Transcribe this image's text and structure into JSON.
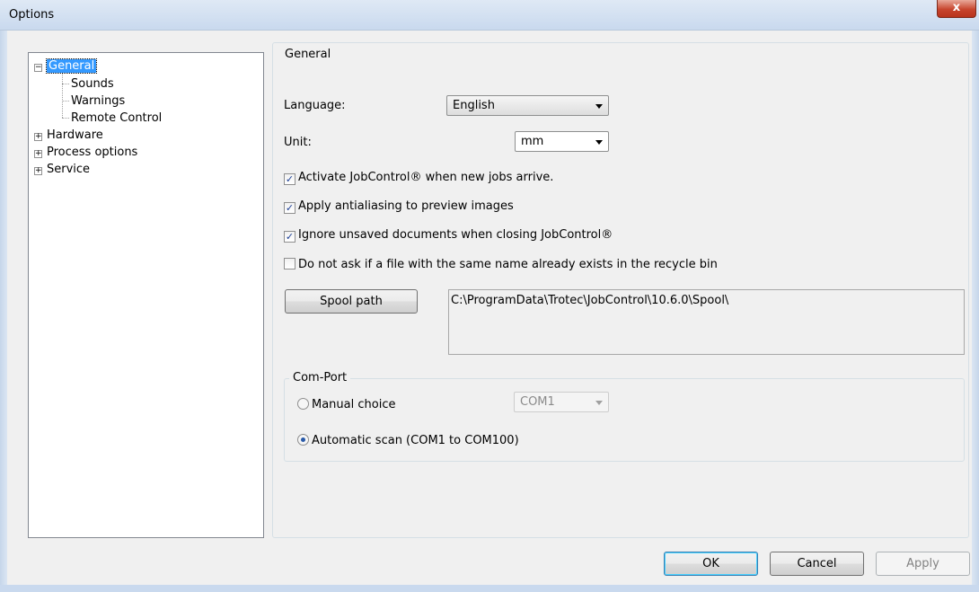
{
  "window": {
    "title": "Options",
    "close_label": "x"
  },
  "tree": {
    "items": [
      {
        "label": "General",
        "expander": "−"
      },
      {
        "label": "Sounds"
      },
      {
        "label": "Warnings"
      },
      {
        "label": "Remote Control"
      },
      {
        "label": "Hardware",
        "expander": "+"
      },
      {
        "label": "Process options",
        "expander": "+"
      },
      {
        "label": "Service",
        "expander": "+"
      }
    ]
  },
  "general": {
    "group_title": "General",
    "language_label": "Language:",
    "language_value": "English",
    "unit_label": "Unit:",
    "unit_value": "mm",
    "checkboxes": [
      {
        "label": "Activate JobControl® when new jobs arrive.",
        "checked": true
      },
      {
        "label": "Apply antialiasing to preview images",
        "checked": true
      },
      {
        "label": "Ignore unsaved documents when closing JobControl®",
        "checked": true
      },
      {
        "label": "Do not ask if a file with the same name already exists in the recycle bin",
        "checked": false
      }
    ],
    "spool_button": "Spool path",
    "spool_path": "C:\\ProgramData\\Trotec\\JobControl\\10.6.0\\Spool\\"
  },
  "comport": {
    "group_title": "Com-Port",
    "manual_label": "Manual choice",
    "manual_value": "COM1",
    "auto_label": "Automatic scan (COM1 to COM100)",
    "selected": "auto"
  },
  "buttons": {
    "ok": "OK",
    "cancel": "Cancel",
    "apply": "Apply"
  }
}
